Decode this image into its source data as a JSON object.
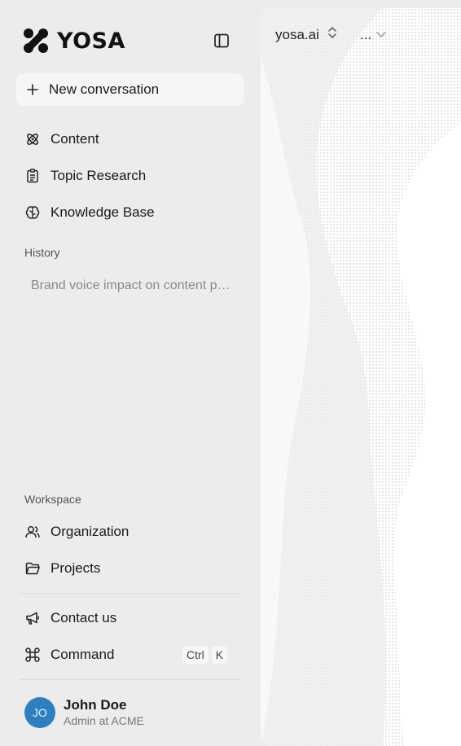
{
  "brand": {
    "name": "YOSA"
  },
  "sidebar": {
    "new_conversation": "New conversation",
    "nav": [
      {
        "label": "Content",
        "icon": "atom-icon"
      },
      {
        "label": "Topic Research",
        "icon": "clipboard-icon"
      },
      {
        "label": "Knowledge Base",
        "icon": "brain-icon"
      }
    ],
    "history_label": "History",
    "history": [
      {
        "title": "Brand voice impact on content performance"
      }
    ],
    "workspace_label": "Workspace",
    "workspace": [
      {
        "label": "Organization",
        "icon": "users-icon"
      },
      {
        "label": "Projects",
        "icon": "folder-icon"
      }
    ],
    "contact": {
      "label": "Contact us",
      "icon": "megaphone-icon"
    },
    "command": {
      "label": "Command",
      "icon": "command-icon",
      "keys": [
        "Ctrl",
        "K"
      ]
    }
  },
  "user": {
    "initials": "JO",
    "name": "John Doe",
    "role": "Admin at ACME"
  },
  "main": {
    "project": "yosa.ai",
    "more": "..."
  },
  "colors": {
    "sidebar_bg": "#ececec",
    "avatar": "#2f7fbf",
    "panel_bg": "#ffffff"
  }
}
